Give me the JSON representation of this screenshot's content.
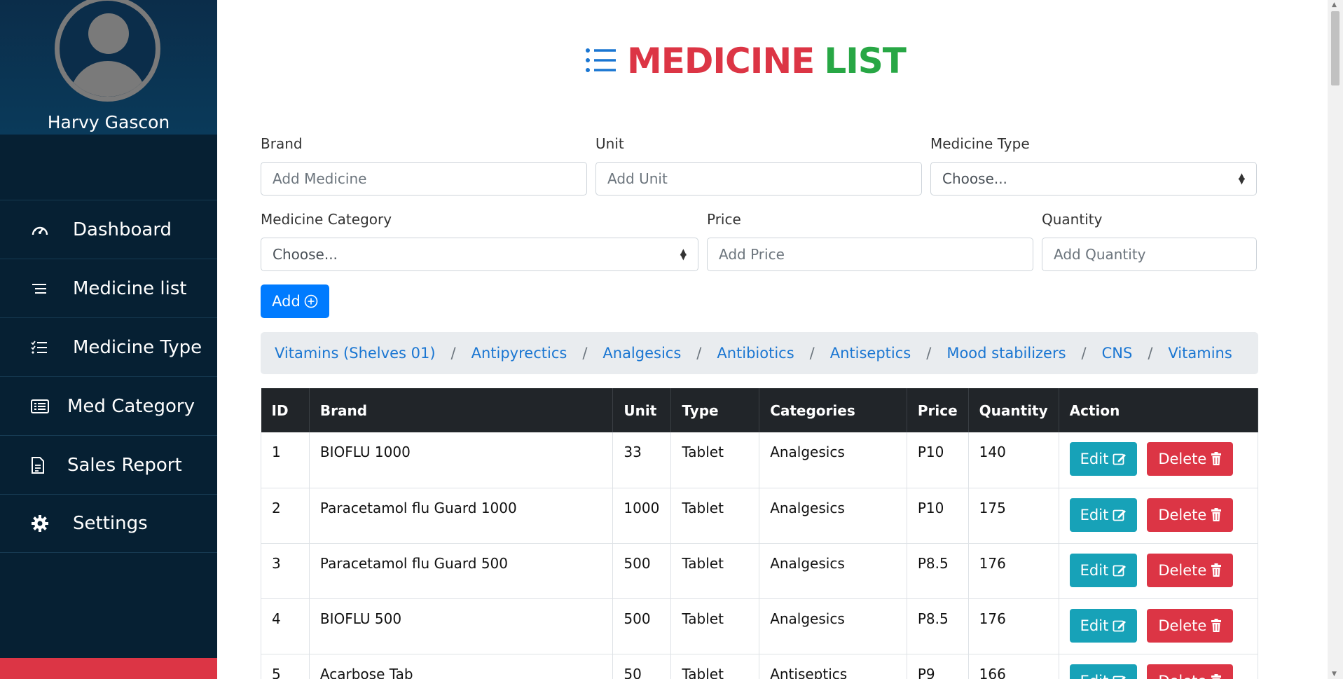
{
  "profile": {
    "name": "Harvy Gascon"
  },
  "nav": [
    {
      "label": "Dashboard",
      "icon": "dashboard-icon"
    },
    {
      "label": "Medicine list",
      "icon": "list-icon"
    },
    {
      "label": "Medicine Type",
      "icon": "checklist-icon"
    },
    {
      "label": "Med Category",
      "icon": "category-icon"
    },
    {
      "label": "Sales Report",
      "icon": "document-icon"
    },
    {
      "label": "Settings",
      "icon": "gear-icon"
    }
  ],
  "page": {
    "title_part1": "MEDICINE",
    "title_part2": "LIST"
  },
  "form": {
    "brand": {
      "label": "Brand",
      "placeholder": "Add Medicine"
    },
    "unit": {
      "label": "Unit",
      "placeholder": "Add Unit"
    },
    "medicine_type": {
      "label": "Medicine Type",
      "value": "Choose..."
    },
    "medicine_category": {
      "label": "Medicine Category",
      "value": "Choose..."
    },
    "price": {
      "label": "Price",
      "placeholder": "Add Price"
    },
    "quantity": {
      "label": "Quantity",
      "placeholder": "Add Quantity"
    },
    "add_label": "Add"
  },
  "categories": [
    "Vitamins (Shelves 01)",
    "Antipyrectics",
    "Analgesics",
    "Antibiotics",
    "Antiseptics",
    "Mood stabilizers",
    "CNS",
    "Vitamins"
  ],
  "table": {
    "headers": [
      "ID",
      "Brand",
      "Unit",
      "Type",
      "Categories",
      "Price",
      "Quantity",
      "Action"
    ],
    "rows": [
      {
        "id": "1",
        "brand": "BIOFLU 1000",
        "unit": "33",
        "type": "Tablet",
        "category": "Analgesics",
        "price": "P10",
        "quantity": "140"
      },
      {
        "id": "2",
        "brand": "Paracetamol flu Guard 1000",
        "unit": "1000",
        "type": "Tablet",
        "category": "Analgesics",
        "price": "P10",
        "quantity": "175"
      },
      {
        "id": "3",
        "brand": "Paracetamol flu Guard 500",
        "unit": "500",
        "type": "Tablet",
        "category": "Analgesics",
        "price": "P8.5",
        "quantity": "176"
      },
      {
        "id": "4",
        "brand": "BIOFLU 500",
        "unit": "500",
        "type": "Tablet",
        "category": "Analgesics",
        "price": "P8.5",
        "quantity": "176"
      },
      {
        "id": "5",
        "brand": "Acarbose Tab",
        "unit": "50",
        "type": "Tablet",
        "category": "Antiseptics",
        "price": "P9",
        "quantity": "166"
      }
    ],
    "edit_label": "Edit",
    "delete_label": "Delete"
  },
  "colors": {
    "sidebar": "#062033",
    "accent_red": "#dc3545",
    "accent_green": "#28a745",
    "primary": "#007bff",
    "info": "#17a2b8"
  }
}
